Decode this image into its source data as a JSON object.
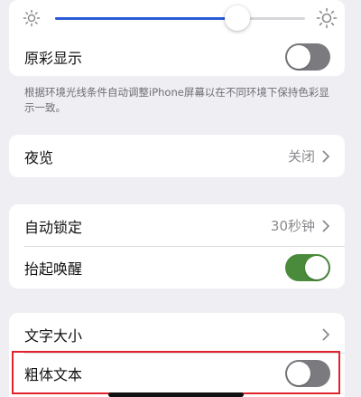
{
  "brightness": {
    "level": 0.73
  },
  "true_tone": {
    "label": "原彩显示",
    "enabled": false
  },
  "footnote": "根据环境光线条件自动调整iPhone屏幕以在不同环境下保持色彩显示一致。",
  "night_shift": {
    "label": "夜览",
    "value": "关闭"
  },
  "auto_lock": {
    "label": "自动锁定",
    "value": "30秒钟"
  },
  "raise_to_wake": {
    "label": "抬起唤醒",
    "enabled": true
  },
  "text_size": {
    "label": "文字大小"
  },
  "bold_text": {
    "label": "粗体文本",
    "enabled": false
  },
  "colors": {
    "slider_fill": "#2a5bd7",
    "toggle_on": "#4a8b3b",
    "highlight": "#e3232c"
  }
}
